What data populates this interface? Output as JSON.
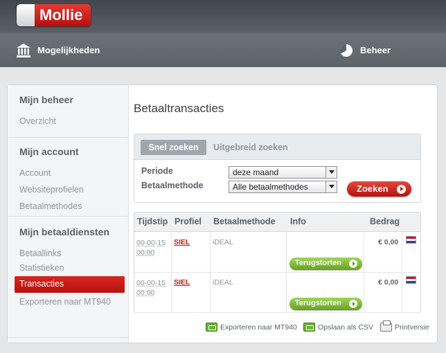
{
  "brand": {
    "name": "Mollie"
  },
  "nav": {
    "left_label": "Mogelijkheden",
    "right_label": "Beheer"
  },
  "sidebar": {
    "sections": [
      {
        "title": "Mijn beheer",
        "items": [
          "Overzicht"
        ]
      },
      {
        "title": "Mijn account",
        "items": [
          "Account",
          "Websiteprofielen",
          "Betaalmethodes"
        ]
      },
      {
        "title": "Mijn betaaldiensten",
        "items": [
          "Betaallinks",
          "Statistieken",
          "Transacties",
          "Exporteren naar MT940"
        ]
      }
    ],
    "active_item": "Transacties"
  },
  "main": {
    "title": "Betaaltransacties",
    "search": {
      "tabs": [
        "Snel zoeken",
        "Uitgebreid zoeken"
      ],
      "active_tab": "Snel zoeken",
      "fields": [
        {
          "label": "Periode",
          "value": "deze maand"
        },
        {
          "label": "Betaalmethode",
          "value": "Alle betaalmethodes"
        }
      ],
      "submit_label": "Zoeken"
    },
    "table": {
      "columns": [
        "Tijdstip",
        "Profiel",
        "Betaalmethode",
        "Info",
        "Bedrag"
      ],
      "rows": [
        {
          "date": "00-00-15",
          "time": "00:00",
          "profile": "SIEL",
          "method": "iDEAL",
          "action": "Terugstorten",
          "amount": "€ 0,00"
        },
        {
          "date": "00-00-15",
          "time": "00:00",
          "profile": "SIEL",
          "method": "iDEAL",
          "action": "Terugstorten",
          "amount": "€ 0,00"
        }
      ]
    },
    "actions": [
      "Exporteren naar MT940",
      "Opslaan als CSV",
      "Printversie"
    ]
  },
  "colors": {
    "brand_red": "#c21a13",
    "refund_green": "#7bbd2f",
    "header_dark": "#4a5057"
  }
}
